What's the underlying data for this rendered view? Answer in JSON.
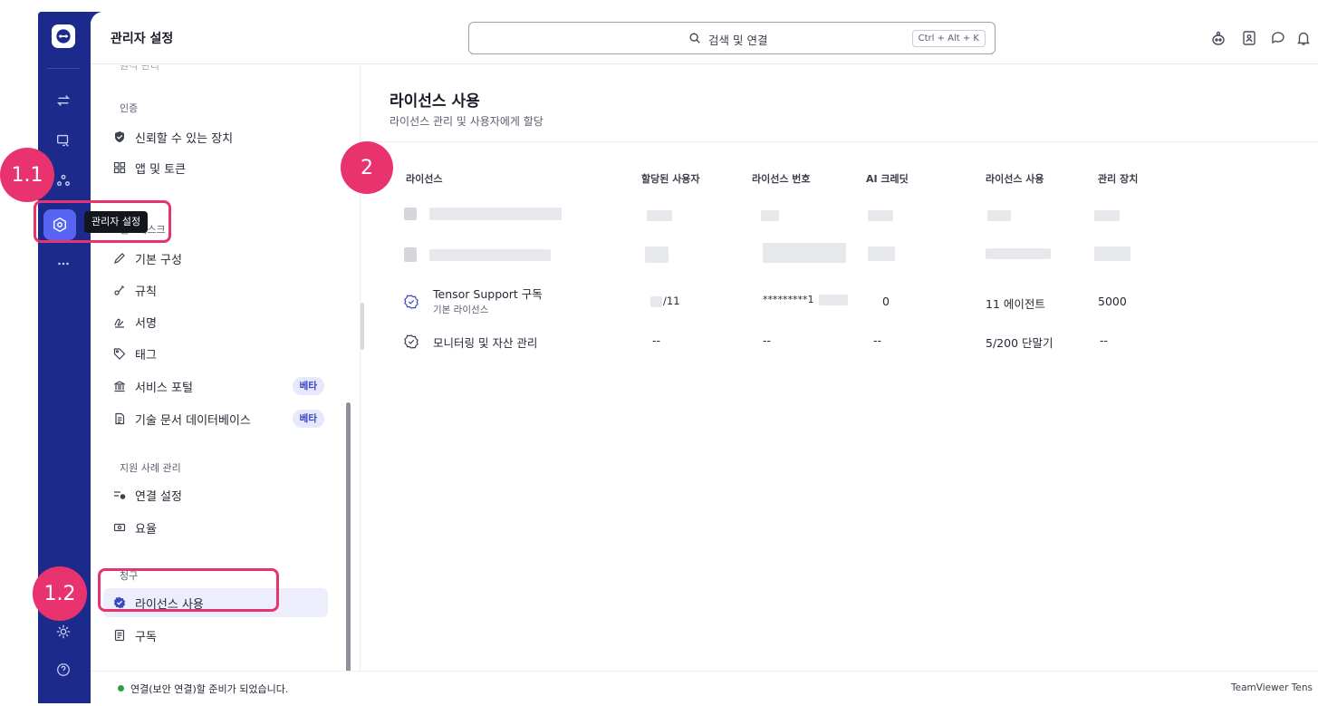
{
  "header": {
    "title": "관리자 설정",
    "search_placeholder": "검색 및 연결",
    "search_shortcut": "Ctrl + Alt + K"
  },
  "rail": {
    "tooltip": "관리자 설정"
  },
  "sidebar": {
    "cut_top_label": "원격 관리",
    "sections": [
      {
        "label": "인증"
      },
      {
        "label": "헬프데스크"
      },
      {
        "label": "지원 사례 관리"
      },
      {
        "label": "청구"
      }
    ],
    "items": [
      {
        "label": "신뢰할 수 있는 장치",
        "icon": "shield-check-icon"
      },
      {
        "label": "앱 및 토큰",
        "icon": "apps-icon"
      },
      {
        "label": "기본 구성",
        "icon": "pencil-icon"
      },
      {
        "label": "규칙",
        "icon": "rule-icon"
      },
      {
        "label": "서명",
        "icon": "signature-icon"
      },
      {
        "label": "태그",
        "icon": "tag-icon"
      },
      {
        "label": "서비스 포털",
        "icon": "bank-icon",
        "badge": "베타"
      },
      {
        "label": "기술 문서 데이터베이스",
        "icon": "document-icon",
        "badge": "베타"
      },
      {
        "label": "연결 설정",
        "icon": "connection-settings-icon"
      },
      {
        "label": "요율",
        "icon": "money-icon"
      },
      {
        "label": "라이선스 사용",
        "icon": "verified-icon",
        "active": true
      },
      {
        "label": "구독",
        "icon": "subscription-icon"
      }
    ]
  },
  "page": {
    "title": "라이선스 사용",
    "subtitle": "라이선스 관리 및 사용자에게 할당"
  },
  "table": {
    "columns": [
      "라이선스",
      "할당된 사용자",
      "라이선스 번호",
      "AI 크레딧",
      "라이선스 사용",
      "관리 장치"
    ],
    "rows": [
      {
        "name": "Tensor Support 구독",
        "sub": "기본 라이선스",
        "users": "/11",
        "number": "*********1",
        "ai": "0",
        "usage": "11 에이전트",
        "devices": "5000"
      },
      {
        "name": "모니터링 및 자산 관리",
        "sub": "",
        "users": "--",
        "number": "--",
        "ai": "--",
        "usage": "5/200 단말기",
        "devices": "--"
      }
    ]
  },
  "status": {
    "text": "연결(보안 연결)할 준비가 되었습니다.",
    "right": "TeamViewer Tens"
  },
  "annotations": [
    "1.1",
    "1.2",
    "2"
  ],
  "colors": {
    "rail": "#1c2a8c",
    "accent": "#3b47c4",
    "annotation": "#e8336e",
    "status_ok": "#2ea043"
  }
}
